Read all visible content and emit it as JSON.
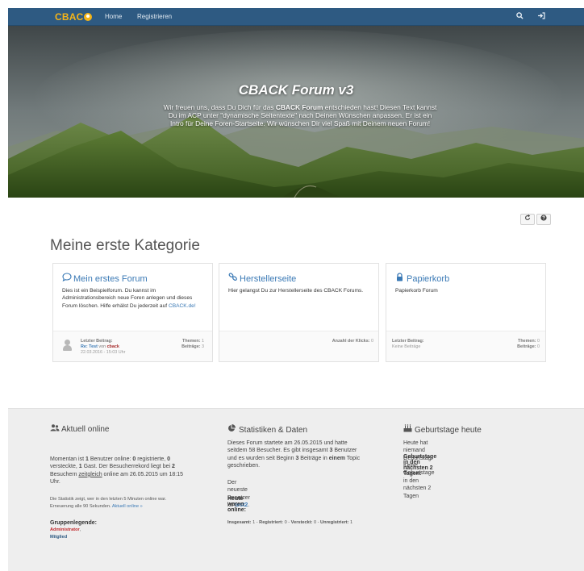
{
  "nav": {
    "logo": "CBAC",
    "home": "Home",
    "register": "Registrieren"
  },
  "hero": {
    "title": "CBACK Forum v3",
    "text_part1": "Wir freuen uns, dass Du Dich für das ",
    "text_bold": "CBACK Forum",
    "text_part2": " entschieden hast! Diesen Text kannst Du im ACP unter \"dynamische Seitentexte\" nach Deinen Wünschen anpassen. Er ist ein Intro für Deine Foren-Startseite. Wir wünschen Dir viel Spaß mit Deinem neuen Forum!"
  },
  "category": {
    "title": "Meine erste Kategorie"
  },
  "forums": [
    {
      "title": "Mein erstes Forum",
      "description": "Dies ist ein Beispielforum. Du kannst im Administrationsbereich neue Foren anlegen und dieses Forum löschen. Hilfe erhälst Du jederzeit auf ",
      "link": "CBACK.de!",
      "last_post_label": "Letzter Beitrag:",
      "last_post_title": "Re: Test",
      "last_post_by": " von ",
      "last_post_author": "cback",
      "last_post_date": "22.03.2016 - 15:03 Uhr",
      "topics_label": "Themen:",
      "topics_value": "1",
      "posts_label": "Beiträge:",
      "posts_value": "3"
    },
    {
      "title": "Herstellerseite",
      "description": "Hier gelangst Du zur Herstellerseite des CBACK Forums.",
      "clicks_label": "Anzahl der Klicks:",
      "clicks_value": "0"
    },
    {
      "title": "Papierkorb",
      "description": "Papierkorb Forum",
      "last_post_label": "Letzter Beitrag:",
      "last_post_none": "Keine Beiträge",
      "topics_label": "Themen:",
      "topics_value": "0",
      "posts_label": "Beiträge:",
      "posts_value": "0"
    }
  ],
  "online": {
    "title": "Aktuell online",
    "l1a": "Momentan ist ",
    "l1b": "1",
    "l1c": " Benutzer online: ",
    "l1d": "0",
    "l1e": " registrierte, ",
    "l1f": "0",
    "l2a": "versteckte, ",
    "l2b": "1",
    "l2c": " Gast. Der Besucherrekord liegt bei ",
    "l2d": "2",
    "l3a": "Besuchern ",
    "l3b": "zeitgleich",
    "l3c": " online am 26.05.2015 um 18:15",
    "l4": "Uhr.",
    "note1": "Die Statistik zeigt, wer in den letzten 5 Minuten online war.",
    "note2": "Erneuerung alle 90 Sekunden. ",
    "note_link": "Aktuell online »",
    "legend_title": "Gruppenlegende:",
    "legend_admin": "Administrator",
    "legend_sep": ", ",
    "legend_member": "Mitglied"
  },
  "stats": {
    "title": "Statistiken & Daten",
    "l1": "Dieses Forum startete am 26.05.2015 und hatte",
    "l2a": "seitdem 58 Besucher. Es gibt insgesamt ",
    "l2b": "3",
    "l2c": " Benutzer",
    "l3a": "und es wurden seit Beginn ",
    "l3b": "3",
    "l3c": " Beiträge in ",
    "l3d": "einem",
    "l3e": " Topic",
    "l4": "geschrieben.",
    "newest_a": "Der neueste Benutzer ist ",
    "newest_user": "test2",
    "newest_b": ".",
    "today_title": "Heute waren online:",
    "total_label": "Insgesamt:",
    "total_value": " 1 - ",
    "reg_label": "Registriert:",
    "reg_value": " 0 - ",
    "hidden_label": "Versteckt:",
    "hidden_value": " 0 - ",
    "unreg_label": "Unregistriert:",
    "unreg_value": " 1"
  },
  "birthdays": {
    "title": "Geburtstage heute",
    "today": "Heute hat niemand Geburtstag",
    "next_title": "Geburtstage in den nächsten 2 Tagen:",
    "next_text": "Keine Geburtstage in den nächsten 2 Tagen"
  },
  "colors": {
    "topbar": "#2e5a82",
    "accent": "#3a79b5",
    "logo": "#f5b418"
  }
}
